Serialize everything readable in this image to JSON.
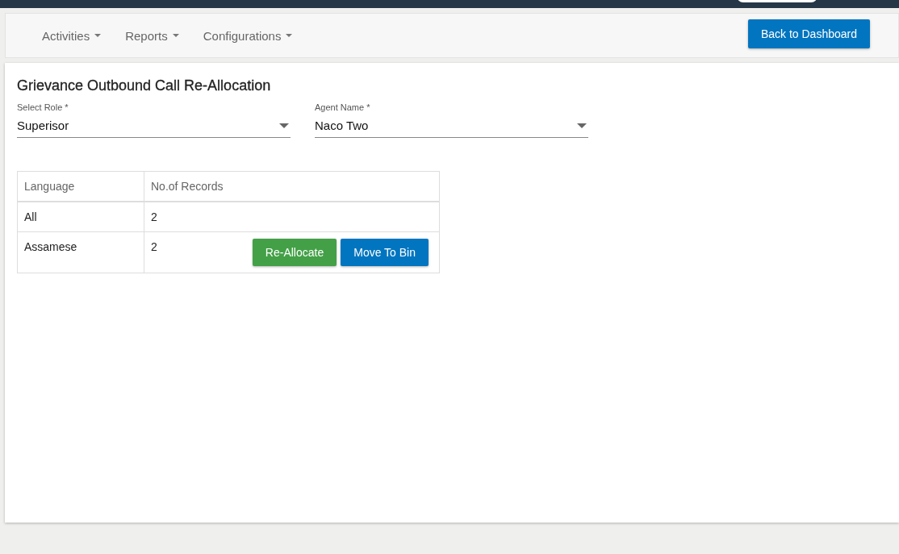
{
  "nav": {
    "menus": [
      {
        "label": "Activities"
      },
      {
        "label": "Reports"
      },
      {
        "label": "Configurations"
      }
    ],
    "back_button": "Back to Dashboard"
  },
  "page_title": "Grievance Outbound Call Re-Allocation",
  "fields": [
    {
      "label": "Select Role *",
      "value": "Superisor"
    },
    {
      "label": "Agent Name *",
      "value": "Naco Two"
    }
  ],
  "table": {
    "columns": [
      "Language",
      "No.of Records"
    ],
    "rows": [
      {
        "language": "All",
        "records": "2",
        "actions": []
      },
      {
        "language": "Assamese",
        "records": "2",
        "actions": [
          {
            "label": "Re-Allocate",
            "kind": "success"
          },
          {
            "label": "Move To Bin",
            "kind": "primary"
          }
        ]
      }
    ]
  }
}
